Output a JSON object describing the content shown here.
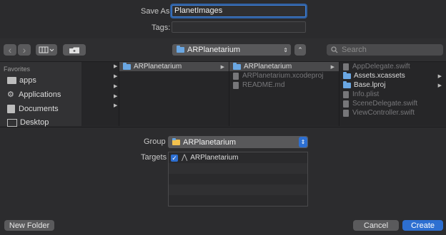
{
  "save_as": {
    "label": "Save As:",
    "value": "PlanetImages"
  },
  "tags": {
    "label": "Tags:",
    "value": ""
  },
  "toolbar": {
    "back_glyph": "‹",
    "forward_glyph": "›",
    "location": "ARPlanetarium",
    "search_placeholder": "Search"
  },
  "sidebar": {
    "section": "Favorites",
    "items": [
      {
        "label": "apps",
        "icon": "folder-icon"
      },
      {
        "label": "Applications",
        "icon": "applications-icon"
      },
      {
        "label": "Documents",
        "icon": "documents-icon"
      },
      {
        "label": "Desktop",
        "icon": "desktop-icon"
      }
    ]
  },
  "columns": {
    "col1": [
      {
        "label": "ARPlanetarium",
        "selected": true
      }
    ],
    "col2": [
      {
        "label": "ARPlanetarium",
        "selected": true
      },
      {
        "label": "ARPlanetarium.xcodeproj",
        "dim": true
      },
      {
        "label": "README.md",
        "dim": true
      }
    ],
    "col3": [
      {
        "label": "AppDelegate.swift",
        "dim": true
      },
      {
        "label": "Assets.xcassets",
        "dim": false
      },
      {
        "label": "Base.lproj",
        "dim": false
      },
      {
        "label": "Info.plist",
        "dim": true
      },
      {
        "label": "SceneDelegate.swift",
        "dim": true
      },
      {
        "label": "ViewController.swift",
        "dim": true
      }
    ]
  },
  "group": {
    "label": "Group",
    "value": "ARPlanetarium"
  },
  "targets": {
    "label": "Targets",
    "items": [
      {
        "label": "ARPlanetarium",
        "checked": true
      }
    ]
  },
  "buttons": {
    "new_folder": "New Folder",
    "cancel": "Cancel",
    "create": "Create"
  },
  "colors": {
    "accent": "#2d6fd1",
    "folder": "#6aa7e3"
  }
}
